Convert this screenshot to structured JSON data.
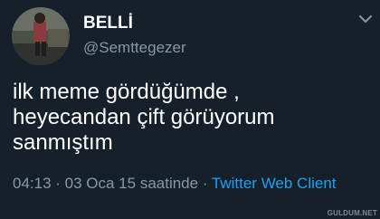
{
  "user": {
    "display_name": "BELLİ",
    "handle": "@Semttegezer"
  },
  "tweet": {
    "lines": [
      "ilk meme gördüğümde ,",
      "heyecandan çift görüyorum",
      "sanmıştım"
    ]
  },
  "meta": {
    "timestamp": "04:13 · 03 Oca 15 saatinde",
    "separator": " · ",
    "client": "Twitter Web Client"
  },
  "watermark": "GULDUM.NET",
  "icons": {
    "menu": "chevron-down-icon",
    "avatar": "avatar"
  },
  "colors": {
    "background": "#15202b",
    "primary_text": "#ffffff",
    "secondary_text": "#8899a6",
    "link": "#1da1f2"
  }
}
